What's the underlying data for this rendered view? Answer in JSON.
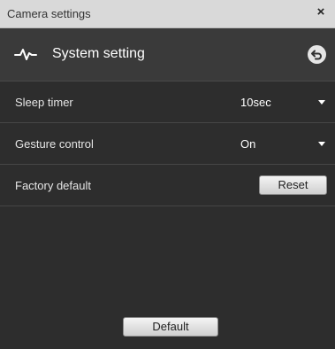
{
  "window": {
    "title": "Camera settings",
    "close_symbol": "×"
  },
  "header": {
    "title": "System setting",
    "icon": "pulse-icon",
    "back_icon": "back-icon"
  },
  "settings": {
    "sleep_timer": {
      "label": "Sleep timer",
      "value": "10sec"
    },
    "gesture_control": {
      "label": "Gesture control",
      "value": "On"
    },
    "factory_default": {
      "label": "Factory default",
      "button": "Reset"
    }
  },
  "footer": {
    "default_button": "Default"
  },
  "colors": {
    "titlebar": "#d9d9d9",
    "header": "#3a3a3a",
    "body": "#2d2d2d",
    "text": "#ffffff"
  }
}
